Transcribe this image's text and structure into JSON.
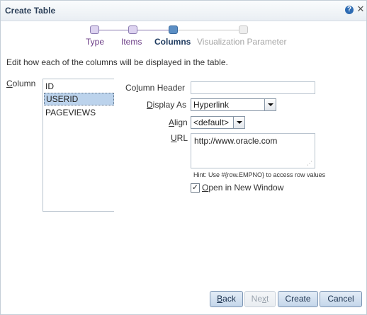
{
  "dialog": {
    "title": "Create Table",
    "help_glyph": "?",
    "close_glyph": "✕"
  },
  "train": {
    "steps": [
      {
        "label": "Type",
        "state": "visited"
      },
      {
        "label": "Items",
        "state": "visited"
      },
      {
        "label": "Columns",
        "state": "current"
      },
      {
        "label": "Visualization Parameter",
        "state": "future"
      }
    ]
  },
  "instruction": "Edit how each of the columns will be displayed in the table.",
  "columns": {
    "label_underlined": "C",
    "label_rest": "olumn",
    "items": [
      "ID",
      "USERID",
      "PAGEVIEWS"
    ],
    "selected_index": 1
  },
  "form": {
    "column_header": {
      "label_pre": "Co",
      "label_u": "l",
      "label_post": "umn Header",
      "value": ""
    },
    "display_as": {
      "label_pre": "",
      "label_u": "D",
      "label_post": "isplay As",
      "value": "Hyperlink"
    },
    "align": {
      "label_pre": "",
      "label_u": "A",
      "label_post": "lign",
      "value": "<default>"
    },
    "url": {
      "label_pre": "",
      "label_u": "U",
      "label_post": "RL",
      "value": "http://www.oracle.com"
    },
    "hint": "Hint: Use #{row.EMPNO} to access row values",
    "open_new_window": {
      "label_pre": "",
      "label_u": "O",
      "label_post": "pen in New Window",
      "checked": true,
      "check_glyph": "✓"
    }
  },
  "buttons": {
    "back": {
      "pre": "",
      "u": "B",
      "post": "ack"
    },
    "next": {
      "pre": "Ne",
      "u": "x",
      "post": "t"
    },
    "create": "Create",
    "cancel": "Cancel"
  }
}
